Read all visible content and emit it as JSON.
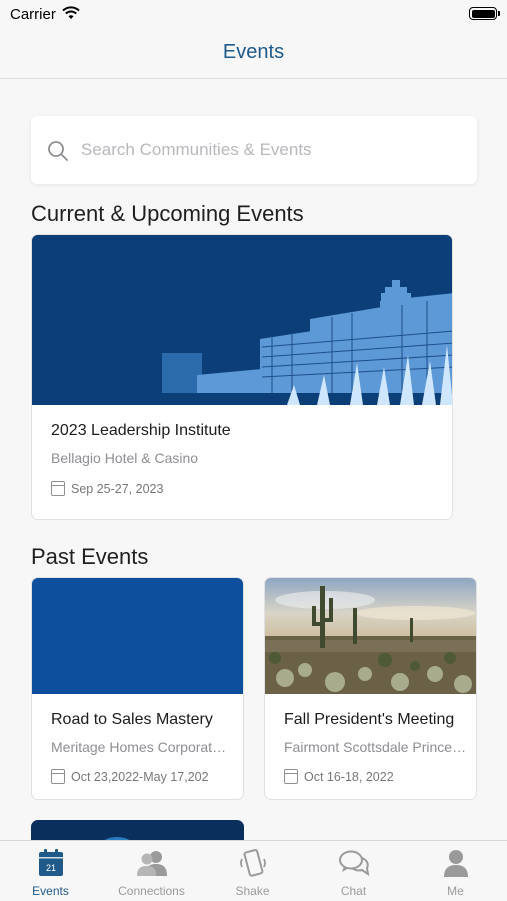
{
  "status_bar": {
    "carrier": "Carrier"
  },
  "nav": {
    "title": "Events"
  },
  "search": {
    "placeholder": "Search Communities & Events"
  },
  "sections": {
    "current_title": "Current & Upcoming Events",
    "past_title": "Past Events"
  },
  "current_events": [
    {
      "title": "2023 Leadership Institute",
      "venue": "Bellagio Hotel & Casino",
      "date": "Sep 25-27, 2023"
    }
  ],
  "past_events": [
    {
      "title": "Road to Sales Mastery",
      "venue": "Meritage Homes Corporate...",
      "date": "Oct 23,2022-May 17,202"
    },
    {
      "title": "Fall President's Meeting",
      "venue": "Fairmont Scottsdale Princes...",
      "date": "Oct 16-18, 2022"
    }
  ],
  "tabs": [
    {
      "label": "Events",
      "icon": "calendar-icon",
      "active": true,
      "badge": "21"
    },
    {
      "label": "Connections",
      "icon": "people-icon",
      "active": false
    },
    {
      "label": "Shake",
      "icon": "phone-shake-icon",
      "active": false
    },
    {
      "label": "Chat",
      "icon": "chat-bubbles-icon",
      "active": false
    },
    {
      "label": "Me",
      "icon": "person-icon",
      "active": false
    }
  ],
  "colors": {
    "accent": "#1f5a8a",
    "card_blue": "#0d4f9c",
    "hero_blue": "#0b3d73"
  }
}
